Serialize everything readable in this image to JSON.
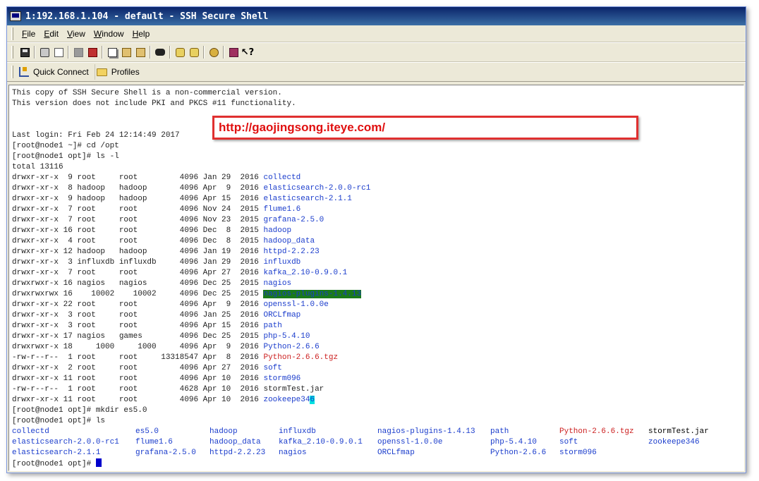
{
  "window": {
    "title": "1:192.168.1.104 - default - SSH Secure Shell"
  },
  "menu": [
    {
      "first": "F",
      "rest": "ile"
    },
    {
      "first": "E",
      "rest": "dit"
    },
    {
      "first": "V",
      "rest": "iew"
    },
    {
      "first": "W",
      "rest": "indow"
    },
    {
      "first": "H",
      "rest": "elp"
    }
  ],
  "toolbar_icons": [
    "save-icon",
    "print-icon",
    "print-preview-icon",
    "disconnect-icon",
    "connect-icon",
    "copy-icon",
    "paste-icon",
    "paste-special-icon",
    "find-icon",
    "settings-icon",
    "profile-settings-icon",
    "sftp-icon",
    "help-book-icon",
    "context-help-icon"
  ],
  "links": {
    "quick_connect": "Quick Connect",
    "profiles": "Profiles"
  },
  "watermark": "http://gaojingsong.iteye.com/",
  "terminal": {
    "lines": [
      {
        "text": "This copy of SSH Secure Shell is a non-commercial version."
      },
      {
        "text": "This version does not include PKI and PKCS #11 functionality."
      },
      {
        "text": ""
      },
      {
        "text": ""
      },
      {
        "text": "Last login: Fri Feb 24 12:14:49 2017"
      },
      {
        "text": "[root@node1 ~]# cd /opt"
      },
      {
        "text": "[root@node1 opt]# ls -l"
      },
      {
        "text": "total 13116"
      },
      {
        "text": "drwxr-xr-x  9 root     root         4096 Jan 29  2016 ",
        "name": "collectd",
        "style": "dir"
      },
      {
        "text": "drwxr-xr-x  8 hadoop   hadoop       4096 Apr  9  2016 ",
        "name": "elasticsearch-2.0.0-rc1",
        "style": "dir"
      },
      {
        "text": "drwxr-xr-x  9 hadoop   hadoop       4096 Apr 15  2016 ",
        "name": "elasticsearch-2.1.1",
        "style": "dir"
      },
      {
        "text": "drwxr-xr-x  7 root     root         4096 Nov 24  2015 ",
        "name": "flume1.6",
        "style": "dir"
      },
      {
        "text": "drwxr-xr-x  7 root     root         4096 Nov 23  2015 ",
        "name": "grafana-2.5.0",
        "style": "dir"
      },
      {
        "text": "drwxr-xr-x 16 root     root         4096 Dec  8  2015 ",
        "name": "hadoop",
        "style": "dir"
      },
      {
        "text": "drwxr-xr-x  4 root     root         4096 Dec  8  2015 ",
        "name": "hadoop_data",
        "style": "dir"
      },
      {
        "text": "drwxr-xr-x 12 hadoop   hadoop       4096 Jan 19  2016 ",
        "name": "httpd-2.2.23",
        "style": "dir"
      },
      {
        "text": "drwxr-xr-x  3 influxdb influxdb     4096 Jan 29  2016 ",
        "name": "influxdb",
        "style": "dir"
      },
      {
        "text": "drwxr-xr-x  7 root     root         4096 Apr 27  2016 ",
        "name": "kafka_2.10-0.9.0.1",
        "style": "dir"
      },
      {
        "text": "drwxrwxr-x 16 nagios   nagios       4096 Dec 25  2015 ",
        "name": "nagios",
        "style": "dir"
      },
      {
        "text": "drwxrwxrwx 16    10002    10002     4096 Dec 25  2015 ",
        "name": "nagios-plugins-1.4.13",
        "style": "hl"
      },
      {
        "text": "drwxr-xr-x 22 root     root         4096 Apr  9  2016 ",
        "name": "openssl-1.0.0e",
        "style": "dir"
      },
      {
        "text": "drwxr-xr-x  3 root     root         4096 Jan 25  2016 ",
        "name": "ORCLfmap",
        "style": "dir"
      },
      {
        "text": "drwxr-xr-x  3 root     root         4096 Apr 15  2016 ",
        "name": "path",
        "style": "dir"
      },
      {
        "text": "drwxr-xr-x 17 nagios   games        4096 Dec 25  2015 ",
        "name": "php-5.4.10",
        "style": "dir"
      },
      {
        "text": "drwxrwxr-x 18     1000     1000     4096 Apr  9  2016 ",
        "name": "Python-2.6.6",
        "style": "dir"
      },
      {
        "text": "-rw-r--r--  1 root     root     13318547 Apr  8  2016 ",
        "name": "Python-2.6.6.tgz",
        "style": "tgz"
      },
      {
        "text": "drwxr-xr-x  2 root     root         4096 Apr 27  2016 ",
        "name": "soft",
        "style": "dir"
      },
      {
        "text": "drwxr-xr-x 11 root     root         4096 Apr 10  2016 ",
        "name": "storm096",
        "style": "dir"
      },
      {
        "text": "-rw-r--r--  1 root     root         4628 Apr 10  2016 ",
        "name": "stormTest.jar",
        "style": "plain"
      },
      {
        "text": "drwxr-xr-x 11 root     root         4096 Apr 10  2016 ",
        "name": "zookeepe34",
        "name_tail": "6",
        "style": "dir"
      },
      {
        "text": "[root@node1 opt]# mkdir es5.0"
      },
      {
        "text": "[root@node1 opt]# ls"
      }
    ],
    "ls_grid": [
      {
        "name": "collectd",
        "style": "dir"
      },
      {
        "name": "es5.0",
        "style": "dir"
      },
      {
        "name": "hadoop",
        "style": "dir"
      },
      {
        "name": "influxdb",
        "style": "dir"
      },
      {
        "name": "nagios-plugins-1.4.13",
        "style": "dir"
      },
      {
        "name": "path",
        "style": "dir"
      },
      {
        "name": "Python-2.6.6.tgz",
        "style": "tgz"
      },
      {
        "name": "stormTest.jar",
        "style": "plain"
      },
      {
        "name": "elasticsearch-2.0.0-rc1",
        "style": "dir"
      },
      {
        "name": "flume1.6",
        "style": "dir"
      },
      {
        "name": "hadoop_data",
        "style": "dir"
      },
      {
        "name": "kafka_2.10-0.9.0.1",
        "style": "dir"
      },
      {
        "name": "openssl-1.0.0e",
        "style": "dir"
      },
      {
        "name": "php-5.4.10",
        "style": "dir"
      },
      {
        "name": "soft",
        "style": "dir"
      },
      {
        "name": "zookeepe346",
        "style": "dir"
      },
      {
        "name": "elasticsearch-2.1.1",
        "style": "dir"
      },
      {
        "name": "grafana-2.5.0",
        "style": "dir"
      },
      {
        "name": "httpd-2.2.23",
        "style": "dir"
      },
      {
        "name": "nagios",
        "style": "dir"
      },
      {
        "name": "ORCLfmap",
        "style": "dir"
      },
      {
        "name": "Python-2.6.6",
        "style": "dir"
      },
      {
        "name": "storm096",
        "style": "dir"
      },
      {
        "name": "",
        "style": "plain"
      }
    ],
    "prompt": "[root@node1 opt]# "
  },
  "colors": {
    "dir": "#1a3ccc",
    "tgz": "#cc2020",
    "highlight_bg": "#1a7a1a",
    "cursor": "#0000cc",
    "watermark_border": "#e03030"
  }
}
